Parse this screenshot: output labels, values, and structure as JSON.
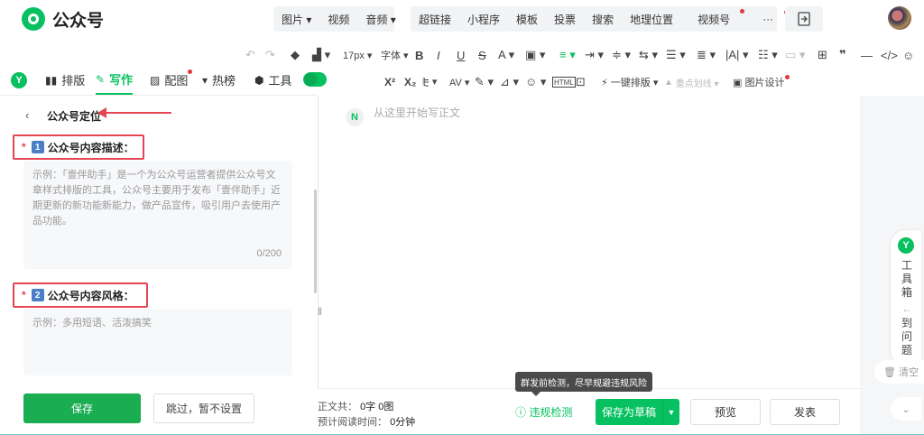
{
  "app": {
    "title": "公众号"
  },
  "topnav": {
    "group1": [
      "图片 ▾",
      "视频",
      "音频 ▾"
    ],
    "group2": [
      "超链接",
      "小程序",
      "模板",
      "投票",
      "搜索",
      "地理位置",
      "视频号",
      "···"
    ]
  },
  "format_toolbar": {
    "font_size": "17px ▾",
    "font_family": "字体 ▾",
    "bold": "B",
    "italic": "I",
    "underline": "U",
    "strike": "S",
    "one_click_format": "一键排版 ▾",
    "highlight": "重点划线 ▾",
    "image_design": "图片设计",
    "superscript": "X²",
    "subscript": "X₂"
  },
  "tabs": [
    {
      "label": "排版",
      "icon": "layout-icon"
    },
    {
      "label": "写作",
      "icon": "write-icon"
    },
    {
      "label": "配图",
      "icon": "image-icon"
    },
    {
      "label": "热榜",
      "icon": "bookmark-icon"
    },
    {
      "label": "工具",
      "icon": "box-icon"
    }
  ],
  "left_panel": {
    "title": "公众号定位",
    "field1": {
      "num": "1",
      "label": "公众号内容描述：",
      "placeholder": "示例：「壹伴助手」是一个为公众号运营者提供公众号文章样式排版的工具，公众号主要用于发布「壹伴助手」近期更新的新功能新能力，做产品宣传，吸引用户去使用产品功能。",
      "counter": "0/200"
    },
    "field2": {
      "num": "2",
      "label": "公众号内容风格：",
      "placeholder": "示例：多用短语、活泼搞笑"
    },
    "save_label": "保存",
    "skip_label": "跳过，暂不设置"
  },
  "editor": {
    "placeholder": "从这里开始写正文"
  },
  "right_strip": {
    "toolbox_label": [
      "工",
      "具",
      "箱"
    ],
    "issues_label": [
      "到",
      "问",
      "题"
    ],
    "clear_label": "清空"
  },
  "bottom": {
    "word_count_line": "正文共：",
    "word_count_value": "0字 0图",
    "read_time_line": "预计阅读时间：",
    "read_time_value": "0分钟",
    "tooltip": "群发前检测，尽早规避违规风险",
    "check_label": "违规检测",
    "draft_label": "保存为草稿",
    "preview_label": "预览",
    "publish_label": "发表"
  },
  "colors": {
    "accent": "#07c160",
    "alert": "#e64553"
  }
}
